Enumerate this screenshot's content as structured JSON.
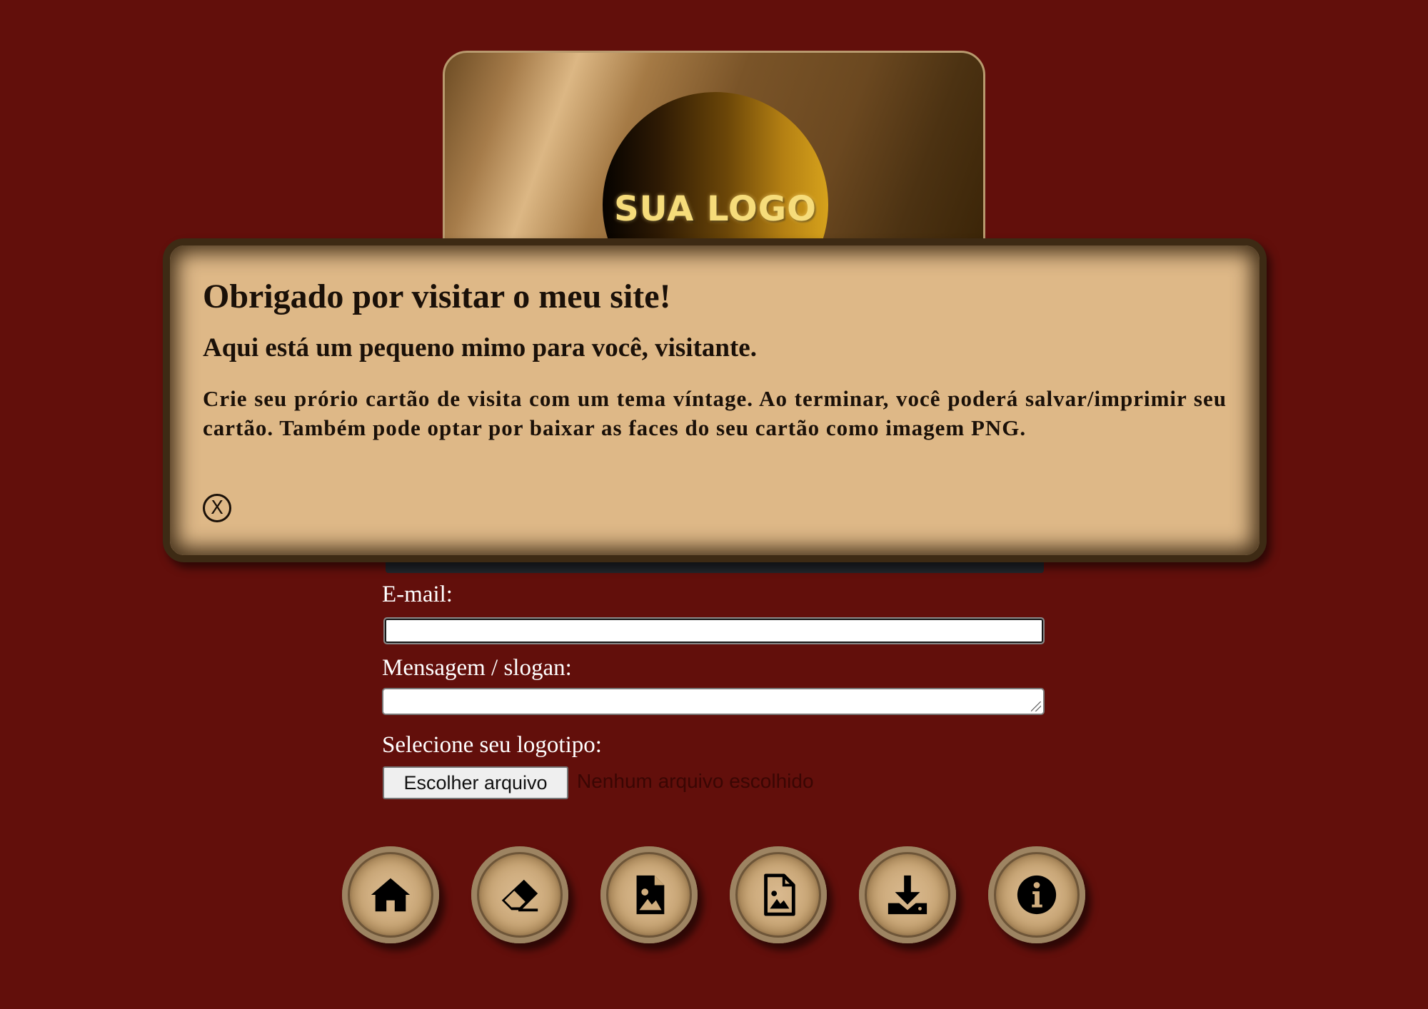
{
  "card": {
    "logo_text": "SUA LOGO"
  },
  "modal": {
    "title": "Obrigado por visitar o meu site!",
    "subtitle": "Aqui está um pequeno mimo para você, visitante.",
    "body": "Crie seu prório cartão de visita com um tema víntage. Ao terminar, você poderá salvar/imprimir seu cartão. Também pode optar por baixar as faces do seu cartão como imagem PNG.",
    "close_label": "X"
  },
  "form": {
    "email_label": "E-mail:",
    "email_value": "",
    "message_label": "Mensagem / slogan:",
    "message_value": "",
    "logo_label": "Selecione seu logotipo:",
    "file_button_label": "Escolher arquivo",
    "file_status": "Nenhum arquivo escolhido"
  },
  "toolbar": {
    "buttons": [
      {
        "icon": "home-icon"
      },
      {
        "icon": "eraser-icon"
      },
      {
        "icon": "file-image-filled-icon"
      },
      {
        "icon": "file-image-outline-icon"
      },
      {
        "icon": "download-icon"
      },
      {
        "icon": "info-icon"
      }
    ]
  },
  "colors": {
    "background": "#620f0b",
    "modal_bg": "#deb887",
    "modal_border": "#3d2a14",
    "logo_text": "#f6dc7a",
    "file_status_text": "#3a0603"
  }
}
